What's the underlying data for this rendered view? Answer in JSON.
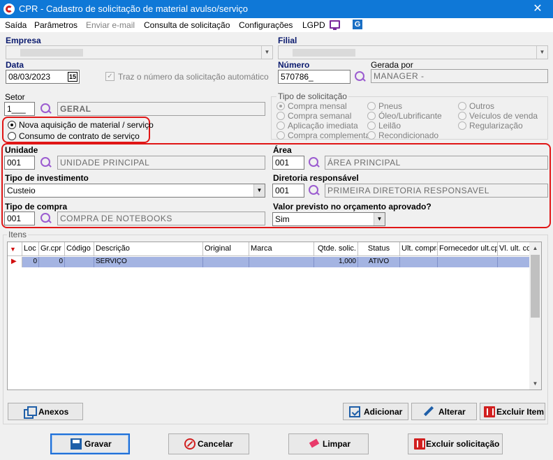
{
  "window": {
    "title": "CPR - Cadastro de solicitação de material avulso/serviço",
    "close": "✕"
  },
  "menu": [
    "Saída",
    "Parâmetros",
    "Enviar e-mail",
    "Consulta de solicitação",
    "Configurações",
    "LGPD"
  ],
  "empresa": {
    "label": "Empresa"
  },
  "filial": {
    "label": "Filial"
  },
  "data": {
    "label": "Data",
    "value": "08/03/2023",
    "calendar": "15"
  },
  "traz_numero": {
    "label": "Traz o número da solicitação automático",
    "checked": "✓"
  },
  "numero": {
    "label": "Número",
    "value": "570786_"
  },
  "gerada_por": {
    "label": "Gerada por",
    "value": "MANAGER -"
  },
  "setor": {
    "label": "Setor",
    "code": "1___",
    "desc": "GERAL"
  },
  "tipo_aquisicao": {
    "options": [
      "Nova aquisição de material / serviço",
      "Consumo de contrato de serviço"
    ]
  },
  "tipo_solicitacao": {
    "title": "Tipo de solicitação",
    "col1": [
      "Compra mensal",
      "Compra semanal",
      "Aplicação imediata",
      "Compra complementar"
    ],
    "col2": [
      "Pneus",
      "Óleo/Lubrificante",
      "Leilão",
      "Recondicionado"
    ],
    "col3": [
      "Outros",
      "Veículos de venda",
      "Regularização"
    ]
  },
  "unidade": {
    "label": "Unidade",
    "code": "001",
    "desc": "UNIDADE PRINCIPAL"
  },
  "area": {
    "label": "Área",
    "code": "001",
    "desc": "ÁREA PRINCIPAL"
  },
  "tipo_investimento": {
    "label": "Tipo de investimento",
    "value": "Custeio"
  },
  "diretoria": {
    "label": "Diretoria responsável",
    "code": "001",
    "desc": "PRIMEIRA DIRETORIA RESPONSAVEL"
  },
  "tipo_compra": {
    "label": "Tipo de compra",
    "code": "001",
    "desc": "COMPRA DE NOTEBOOKS"
  },
  "valor_previsto": {
    "label": "Valor previsto no orçamento aprovado?",
    "value": "Sim"
  },
  "itens": {
    "title": "Itens",
    "columns": [
      "Loc",
      "Gr.cpr",
      "Código",
      "Descrição",
      "Original",
      "Marca",
      "Qtde. solic.",
      "Status",
      "Ult. compra",
      "Fornecedor ult.cpr",
      "Vl. ult. com"
    ],
    "row": [
      "0",
      "0",
      "",
      "SERVIÇO",
      "",
      "",
      "1,000",
      "ATIVO",
      "",
      "",
      ""
    ]
  },
  "buttons": {
    "anexos": "Anexos",
    "adicionar": "Adicionar",
    "alterar": "Alterar",
    "excluir_item": "Excluir Item",
    "gravar": "Gravar",
    "cancelar": "Cancelar",
    "limpar": "Limpar",
    "excluir_solicitacao": "Excluir solicitação"
  }
}
